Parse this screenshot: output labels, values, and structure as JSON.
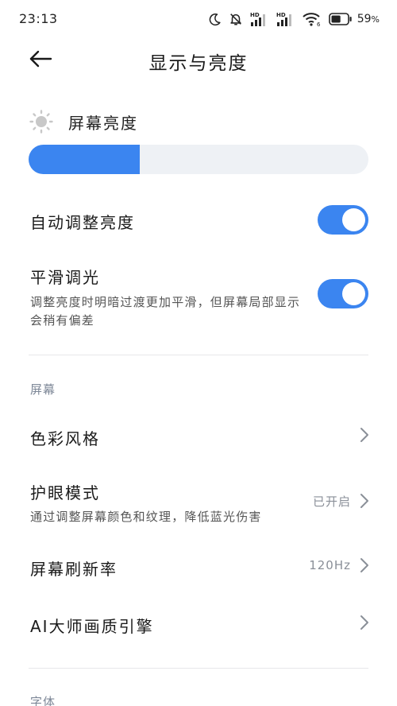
{
  "status_bar": {
    "time": "23:13",
    "battery_percent": "59",
    "battery_suffix": "%",
    "signal_1_label": "HD",
    "signal_2_label": "HD",
    "wifi_label": "6",
    "battery_level": 0.59
  },
  "header": {
    "title": "显示与亮度"
  },
  "brightness": {
    "label": "屏幕亮度",
    "level_percent": 32.7
  },
  "toggles": [
    {
      "title": "自动调整亮度",
      "subtitle": "",
      "on": true
    },
    {
      "title": "平滑调光",
      "subtitle": "调整亮度时明暗过渡更加平滑，但屏幕局部显示会稍有偏差",
      "on": true
    }
  ],
  "sections": {
    "screen": {
      "label": "屏幕",
      "items": [
        {
          "title": "色彩风格",
          "subtitle": "",
          "value": ""
        },
        {
          "title": "护眼模式",
          "subtitle": "通过调整屏幕颜色和纹理，降低蓝光伤害",
          "value": "已开启"
        },
        {
          "title": "屏幕刷新率",
          "subtitle": "",
          "value": "120Hz"
        },
        {
          "title": "AI大师画质引擎",
          "subtitle": "",
          "value": ""
        }
      ]
    },
    "font": {
      "label": "字体"
    }
  },
  "colors": {
    "accent": "#3b85f0",
    "track": "#eef1f5",
    "section_label": "#7d8797"
  }
}
